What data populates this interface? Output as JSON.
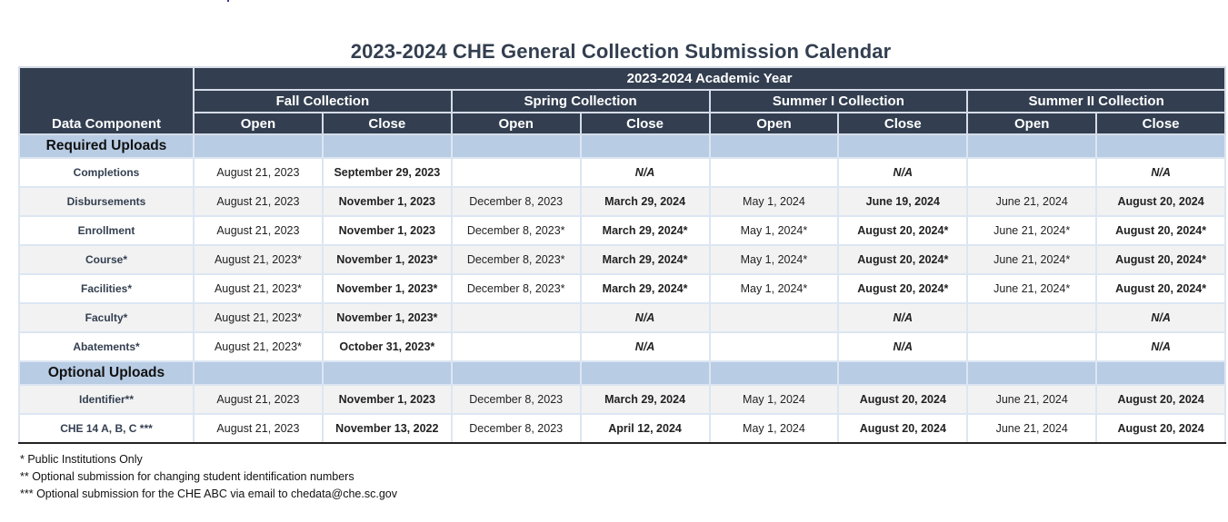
{
  "title": "2023-2024 CHE General Collection Submission Calendar",
  "header": {
    "data_component_label": "Data Component",
    "academic_year": "2023-2024 Academic Year",
    "collections": [
      "Fall Collection",
      "Spring Collection",
      "Summer I Collection",
      "Summer II Collection"
    ],
    "open_label": "Open",
    "close_label": "Close"
  },
  "sections": [
    {
      "label": "Required Uploads",
      "rows": [
        {
          "name": "Completions",
          "cells": [
            {
              "text": "August 21, 2023",
              "style": "normal"
            },
            {
              "text": "September 29, 2023",
              "style": "bold"
            },
            {
              "text": "",
              "style": "normal"
            },
            {
              "text": "N/A",
              "style": "italic"
            },
            {
              "text": "",
              "style": "normal"
            },
            {
              "text": "N/A",
              "style": "italic"
            },
            {
              "text": "",
              "style": "normal"
            },
            {
              "text": "N/A",
              "style": "italic"
            }
          ]
        },
        {
          "name": "Disbursements",
          "cells": [
            {
              "text": "August 21, 2023",
              "style": "normal"
            },
            {
              "text": "November 1, 2023",
              "style": "semibold"
            },
            {
              "text": "December 8, 2023",
              "style": "normal"
            },
            {
              "text": "March 29, 2024",
              "style": "semibold"
            },
            {
              "text": "May 1, 2024",
              "style": "normal"
            },
            {
              "text": "June 19, 2024",
              "style": "semibold"
            },
            {
              "text": "June 21, 2024",
              "style": "normal"
            },
            {
              "text": "August 20, 2024",
              "style": "bold"
            }
          ]
        },
        {
          "name": "Enrollment",
          "cells": [
            {
              "text": "August 21, 2023",
              "style": "normal"
            },
            {
              "text": "November 1, 2023",
              "style": "bold"
            },
            {
              "text": "December 8, 2023*",
              "style": "normal"
            },
            {
              "text": "March 29, 2024*",
              "style": "semibold"
            },
            {
              "text": "May 1, 2024*",
              "style": "normal"
            },
            {
              "text": "August 20, 2024*",
              "style": "semibold"
            },
            {
              "text": "June 21, 2024*",
              "style": "normal"
            },
            {
              "text": "August 20, 2024*",
              "style": "semibold"
            }
          ]
        },
        {
          "name": "Course*",
          "cells": [
            {
              "text": "August 21, 2023*",
              "style": "normal"
            },
            {
              "text": "November 1, 2023*",
              "style": "bold"
            },
            {
              "text": "December 8, 2023*",
              "style": "normal"
            },
            {
              "text": "March 29, 2024*",
              "style": "semibold"
            },
            {
              "text": "May 1, 2024*",
              "style": "normal"
            },
            {
              "text": "August 20, 2024*",
              "style": "semibold"
            },
            {
              "text": "June 21, 2024*",
              "style": "normal"
            },
            {
              "text": "August 20, 2024*",
              "style": "semibold"
            }
          ]
        },
        {
          "name": "Facilities*",
          "cells": [
            {
              "text": "August 21, 2023*",
              "style": "normal"
            },
            {
              "text": "November 1, 2023*",
              "style": "bold"
            },
            {
              "text": "December 8, 2023*",
              "style": "normal"
            },
            {
              "text": "March 29, 2024*",
              "style": "semibold"
            },
            {
              "text": "May 1, 2024*",
              "style": "normal"
            },
            {
              "text": "August 20, 2024*",
              "style": "semibold"
            },
            {
              "text": "June 21, 2024*",
              "style": "normal"
            },
            {
              "text": "August 20, 2024*",
              "style": "semibold"
            }
          ]
        },
        {
          "name": "Faculty*",
          "cells": [
            {
              "text": "August 21, 2023*",
              "style": "normal"
            },
            {
              "text": "November 1, 2023*",
              "style": "semibold"
            },
            {
              "text": "",
              "style": "normal"
            },
            {
              "text": "N/A",
              "style": "italic"
            },
            {
              "text": "",
              "style": "normal"
            },
            {
              "text": "N/A",
              "style": "italic"
            },
            {
              "text": "",
              "style": "normal"
            },
            {
              "text": "N/A",
              "style": "italic"
            }
          ]
        },
        {
          "name": "Abatements*",
          "cells": [
            {
              "text": "August 21, 2023*",
              "style": "normal"
            },
            {
              "text": "October 31, 2023*",
              "style": "bold"
            },
            {
              "text": "",
              "style": "normal"
            },
            {
              "text": "N/A",
              "style": "italic"
            },
            {
              "text": "",
              "style": "normal"
            },
            {
              "text": "N/A",
              "style": "italic"
            },
            {
              "text": "",
              "style": "normal"
            },
            {
              "text": "N/A",
              "style": "italic"
            }
          ]
        }
      ]
    },
    {
      "label": "Optional Uploads",
      "rows": [
        {
          "name": "Identifier**",
          "cells": [
            {
              "text": "August 21, 2023",
              "style": "normal"
            },
            {
              "text": "November 1, 2023",
              "style": "bold"
            },
            {
              "text": "December 8, 2023",
              "style": "normal"
            },
            {
              "text": "March 29, 2024",
              "style": "semibold"
            },
            {
              "text": "May 1, 2024",
              "style": "normal"
            },
            {
              "text": "August 20, 2024",
              "style": "semibold"
            },
            {
              "text": "June 21, 2024",
              "style": "normal"
            },
            {
              "text": "August 20, 2024",
              "style": "semibold"
            }
          ]
        },
        {
          "name": "CHE 14 A, B, C ***",
          "cells": [
            {
              "text": "August 21, 2023",
              "style": "normal"
            },
            {
              "text": "November 13, 2022",
              "style": "semibold"
            },
            {
              "text": "December 8, 2023",
              "style": "normal"
            },
            {
              "text": "April 12, 2024",
              "style": "bold"
            },
            {
              "text": "May 1, 2024",
              "style": "normal"
            },
            {
              "text": "August 20, 2024",
              "style": "semibold"
            },
            {
              "text": "June 21, 2024",
              "style": "normal"
            },
            {
              "text": "August 20, 2024",
              "style": "bold"
            }
          ]
        }
      ]
    }
  ],
  "footnotes": [
    "* Public Institutions Only",
    "** Optional submission for changing student identification numbers",
    "*** Optional submission for the CHE ABC via email to chedata@che.sc.gov"
  ],
  "colors": {
    "header_bg": "#333f50",
    "section_bg": "#b8cce4",
    "alt_row_bg": "#f2f2f2",
    "title_color": "#333f50"
  }
}
